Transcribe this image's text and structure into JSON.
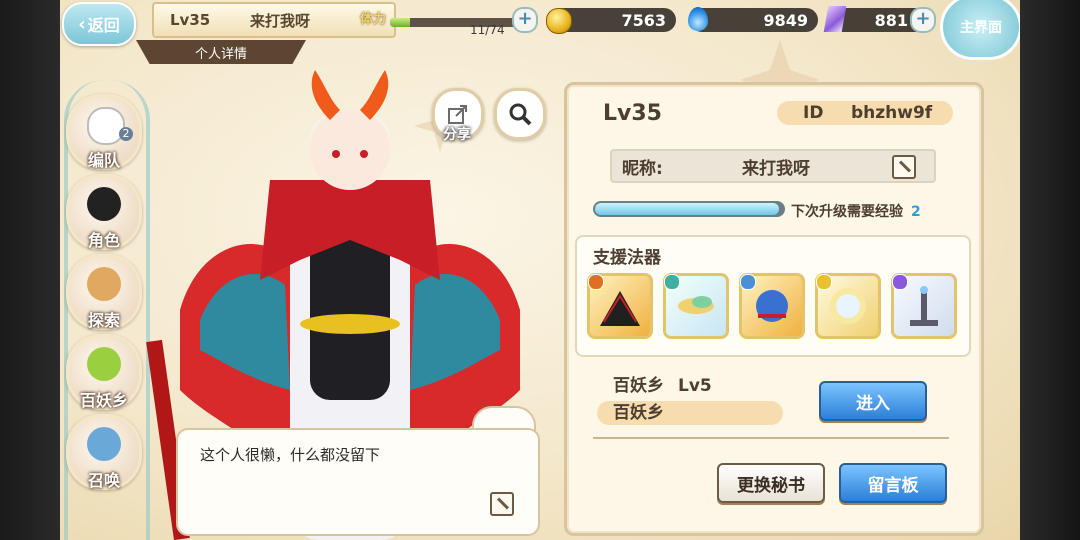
{
  "topbar": {
    "back_label": "返回",
    "level": "Lv35",
    "player_name": "来打我呀",
    "subtab_label": "个人详情",
    "stamina_label": "体力",
    "stamina_value": "11/74",
    "stamina_fraction": 0.15,
    "coins": "7563",
    "spirit": "9849",
    "gems": "881",
    "home_label": "主界面"
  },
  "leftnav": {
    "items": [
      {
        "label": "编队",
        "badge": "2"
      },
      {
        "label": "角色"
      },
      {
        "label": "探索"
      },
      {
        "label": "百妖乡"
      },
      {
        "label": "召唤"
      }
    ]
  },
  "character": {
    "share_label": "分享",
    "bio": "这个人很懒，什么都没留下"
  },
  "panel": {
    "level": "Lv35",
    "id_label": "ID",
    "id_value": "bhzhw9f",
    "nickname_label": "昵称:",
    "nickname_value": "来打我呀",
    "xp_fraction": 0.98,
    "xp_label": "下次升级需要经验",
    "xp_value": "2",
    "support_title": "支援法器",
    "support_items": [
      {
        "name": "black-fan-artifact",
        "color": "#e8a030"
      },
      {
        "name": "feather-ring-artifact",
        "color": "#3fb0a0"
      },
      {
        "name": "blue-dragon-artifact",
        "color": "#4a8fd8"
      },
      {
        "name": "sun-mirror-artifact",
        "color": "#e8c030"
      },
      {
        "name": "candle-stand-artifact",
        "color": "#8a5ad8"
      }
    ],
    "home_name_label": "百妖乡",
    "home_level": "Lv5",
    "home_field": "百妖乡",
    "enter_button": "进入",
    "change_secretary_button": "更换秘书",
    "message_board_button": "留言板"
  }
}
